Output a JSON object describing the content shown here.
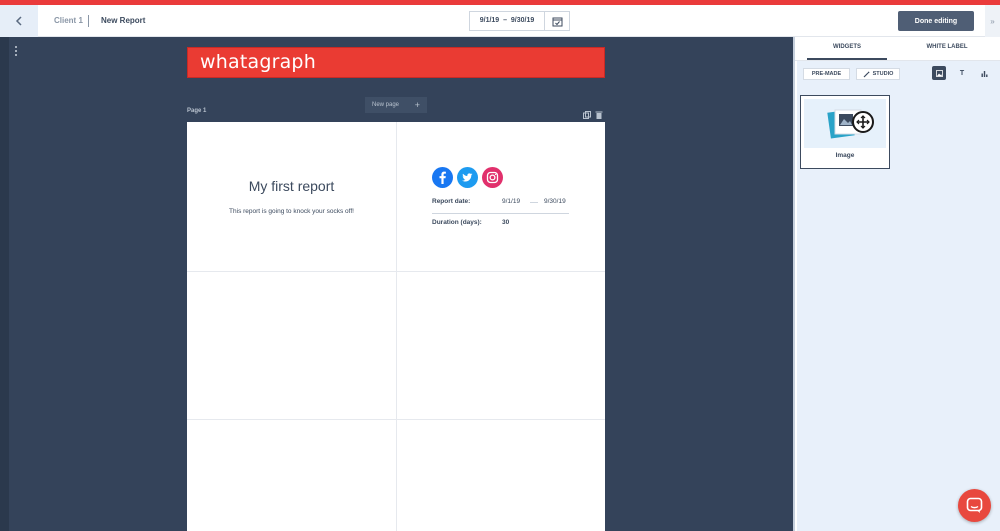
{
  "colors": {
    "accent": "#ea3b3b",
    "sidebar_bg": "#e8f0fa",
    "canvas_bg": "#34435a",
    "primary_dark": "#4f5e75"
  },
  "header": {
    "back_icon": "chevron-left-icon",
    "breadcrumb_client": "Client 1",
    "breadcrumb_report": "New Report",
    "date_from": "9/1/19",
    "date_to": "9/30/19",
    "calendar_icon": "calendar-check-icon",
    "done_button": "Done editing",
    "collapse_icon": "double-chevron-icon"
  },
  "brand": {
    "logo_text": "whatagraph"
  },
  "page_controls": {
    "page_label": "Page 1",
    "new_page": "New page",
    "plus": "+"
  },
  "report": {
    "title": "My first report",
    "subtitle": "This report is going to knock your socks off!",
    "social_icons": [
      "facebook-icon",
      "twitter-icon",
      "instagram-icon"
    ],
    "report_date_label": "Report date:",
    "report_date_from": "9/1/19",
    "report_date_to": "9/30/19",
    "duration_label": "Duration (days):",
    "duration_value": "30"
  },
  "sidebar": {
    "tab_widgets": "WIDGETS",
    "tab_white_label": "WHITE LABEL",
    "premade": "PRE-MADE",
    "studio": "STUDIO",
    "filter_image_icon": "image-icon",
    "filter_text_icon": "text-icon",
    "filter_chart_icon": "bar-chart-icon",
    "widget_image_label": "Image"
  },
  "chat_icon": "chat-bubble-icon"
}
